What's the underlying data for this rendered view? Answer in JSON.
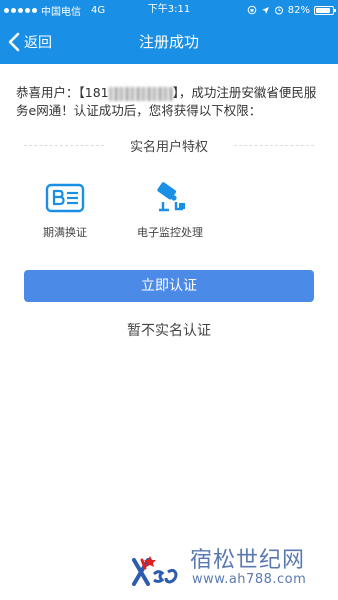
{
  "status_bar": {
    "carrier": "中国电信",
    "network": "4G",
    "time": "下午3:11",
    "battery": "82%"
  },
  "nav": {
    "back_label": "返回",
    "title": "注册成功"
  },
  "congrats": {
    "prefix": "恭喜用户：【181",
    "suffix": "】，成功注册安徽省便民服务e网通！认证成功后，您将获得以下权限："
  },
  "section": {
    "title": "实名用户特权"
  },
  "privileges": [
    {
      "label": "期满换证",
      "icon": "id-card-icon"
    },
    {
      "label": "电子监控处理",
      "icon": "camera-icon"
    }
  ],
  "actions": {
    "verify_label": "立即认证",
    "skip_label": "暂不实名认证"
  },
  "watermark": {
    "title": "宿松世纪网",
    "url": "www.ah788.com"
  },
  "colors": {
    "header": "#1a8fe6",
    "button": "#4b8ae6",
    "icon": "#1a8fe6"
  }
}
